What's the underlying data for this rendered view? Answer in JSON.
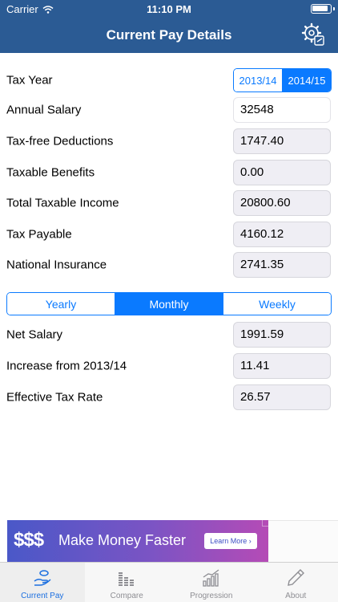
{
  "status": {
    "carrier": "Carrier",
    "time": "11:10 PM"
  },
  "nav": {
    "title": "Current Pay Details",
    "settings_icon": "gear-settings-icon"
  },
  "tax_year": {
    "label": "Tax Year",
    "options": [
      "2013/14",
      "2014/15"
    ],
    "selected": "2014/15"
  },
  "fields": [
    {
      "label": "Annual Salary",
      "value": "32548",
      "editable": true
    },
    {
      "label": "Tax-free Deductions",
      "value": "1747.40"
    },
    {
      "label": "Taxable Benefits",
      "value": "0.00"
    },
    {
      "label": "Total Taxable Income",
      "value": "20800.60"
    },
    {
      "label": "Tax Payable",
      "value": "4160.12"
    },
    {
      "label": "National Insurance",
      "value": "2741.35"
    }
  ],
  "period": {
    "options": [
      "Yearly",
      "Monthly",
      "Weekly"
    ],
    "selected": "Monthly"
  },
  "results": [
    {
      "label": "Net Salary",
      "value": "1991.59"
    },
    {
      "label": "Increase from 2013/14",
      "value": "11.41"
    },
    {
      "label": "Effective Tax Rate",
      "value": "26.57"
    }
  ],
  "ad": {
    "dollar": "$$$",
    "text": "Make Money Faster",
    "button": "Learn More ›"
  },
  "tabs": [
    {
      "label": "Current Pay",
      "icon": "money-hand-icon",
      "active": true
    },
    {
      "label": "Compare",
      "icon": "equalizer-icon"
    },
    {
      "label": "Progression",
      "icon": "bar-chart-icon"
    },
    {
      "label": "About",
      "icon": "pencil-icon"
    }
  ],
  "colors": {
    "nav_bar": "#2b5b94",
    "accent": "#0a7aff",
    "tab_active": "#1b6fe0",
    "tab_inactive": "#8e8e93"
  }
}
